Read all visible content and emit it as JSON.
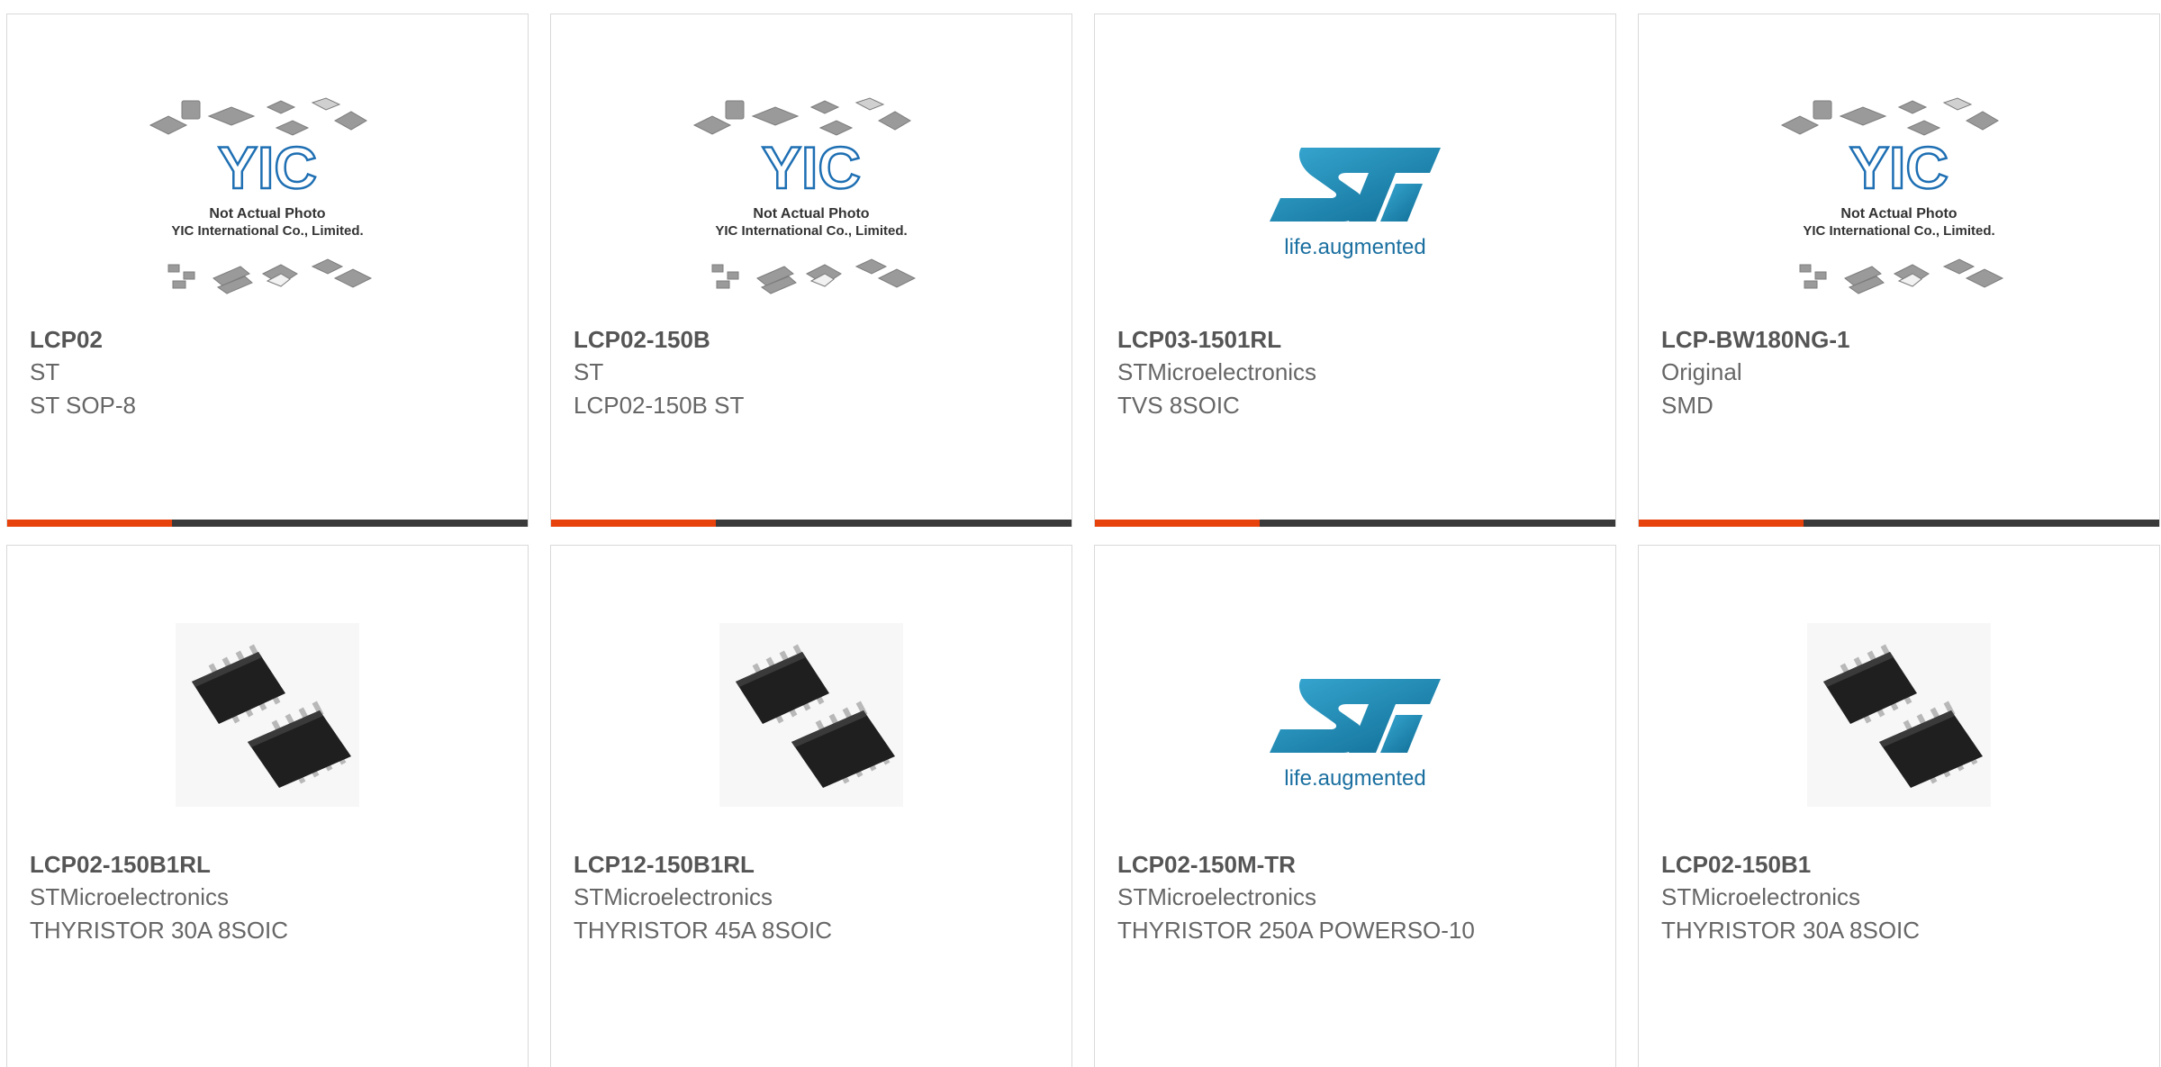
{
  "colors": {
    "accent": "#e8420c",
    "bar_dark": "#3a3a3a",
    "card_border": "#d9d9d9",
    "st_blue": "#1b89b5",
    "yic_blue": "#1e6fb3"
  },
  "products": [
    {
      "part": "LCP02",
      "maker": "ST",
      "desc": "ST SOP-8",
      "image": "yic-placeholder-image",
      "placeholder_line1": "Not Actual Photo",
      "placeholder_line2": "YIC International Co., Limited."
    },
    {
      "part": "LCP02-150B",
      "maker": "ST",
      "desc": "LCP02-150B ST",
      "image": "yic-placeholder-image",
      "placeholder_line1": "Not Actual Photo",
      "placeholder_line2": "YIC International Co., Limited."
    },
    {
      "part": "LCP03-1501RL",
      "maker": "STMicroelectronics",
      "desc": "TVS 8SOIC",
      "image": "st-logo-image",
      "logo_tagline": "life.augmented"
    },
    {
      "part": "LCP-BW180NG-1",
      "maker": "Original",
      "desc": "SMD",
      "image": "yic-placeholder-image",
      "placeholder_line1": "Not Actual Photo",
      "placeholder_line2": "YIC International Co., Limited."
    },
    {
      "part": "LCP02-150B1RL",
      "maker": "STMicroelectronics",
      "desc": "THYRISTOR 30A 8SOIC",
      "image": "soic-chip-image"
    },
    {
      "part": "LCP12-150B1RL",
      "maker": "STMicroelectronics",
      "desc": "THYRISTOR 45A 8SOIC",
      "image": "soic-chip-image"
    },
    {
      "part": "LCP02-150M-TR",
      "maker": "STMicroelectronics",
      "desc": "THYRISTOR 250A POWERSO-10",
      "image": "st-logo-image",
      "logo_tagline": "life.augmented"
    },
    {
      "part": "LCP02-150B1",
      "maker": "STMicroelectronics",
      "desc": "THYRISTOR 30A 8SOIC",
      "image": "soic-chip-image"
    }
  ]
}
